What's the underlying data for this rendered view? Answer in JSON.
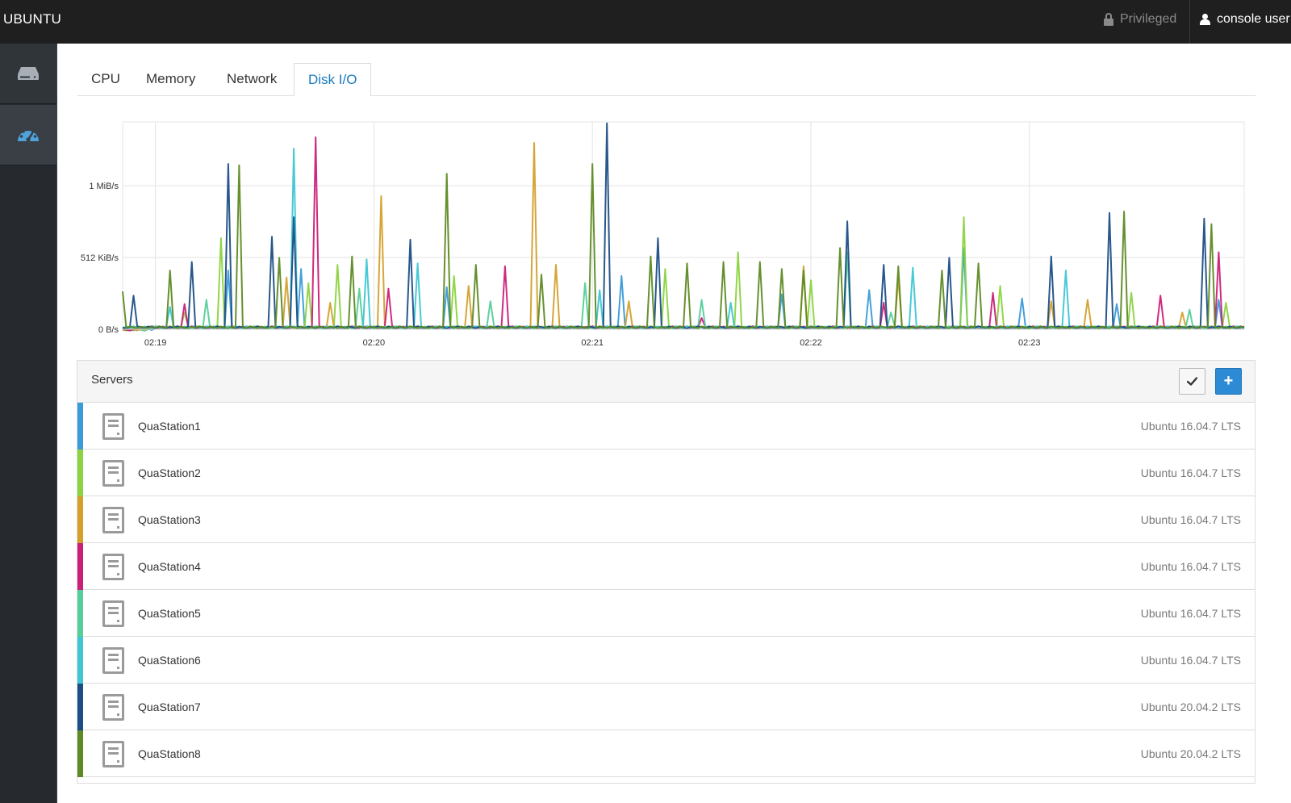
{
  "header": {
    "brand": "UBUNTU",
    "privileged_label": "Privileged",
    "user_label": "console user"
  },
  "sidebar": {
    "items": [
      {
        "icon": "server-rack-icon",
        "active": false
      },
      {
        "icon": "dashboard-gauge-icon",
        "active": true
      }
    ]
  },
  "tabs": [
    {
      "label": "CPU",
      "active": false
    },
    {
      "label": "Memory",
      "active": false
    },
    {
      "label": "Network",
      "active": false
    },
    {
      "label": "Disk I/O",
      "active": true
    }
  ],
  "chart_data": {
    "type": "line",
    "xlabel": "",
    "ylabel": "",
    "y_unit": "KiB/s",
    "y_ticks": [
      {
        "value": 0,
        "label": "0 B/s"
      },
      {
        "value": 512,
        "label": "512 KiB/s"
      },
      {
        "value": 1024,
        "label": "1 MiB/s"
      }
    ],
    "ylim": [
      0,
      1480
    ],
    "x_ticks": [
      "02:19",
      "02:20",
      "02:21",
      "02:22",
      "02:23"
    ],
    "x_range_seconds": [
      -9,
      299
    ],
    "grid": true,
    "series": [
      {
        "color": "#3b9bd8",
        "peaks": [
          [
            20,
            420
          ],
          [
            40,
            430
          ],
          [
            80,
            300
          ],
          [
            128,
            380
          ],
          [
            172,
            250
          ],
          [
            196,
            280
          ],
          [
            222,
            580
          ],
          [
            238,
            220
          ],
          [
            264,
            180
          ],
          [
            292,
            210
          ]
        ]
      },
      {
        "color": "#8bd43f",
        "peaks": [
          [
            8,
            120
          ],
          [
            18,
            650
          ],
          [
            42,
            330
          ],
          [
            50,
            460
          ],
          [
            82,
            380
          ],
          [
            140,
            430
          ],
          [
            160,
            550
          ],
          [
            180,
            350
          ],
          [
            222,
            800
          ],
          [
            232,
            310
          ],
          [
            268,
            260
          ],
          [
            294,
            190
          ]
        ]
      },
      {
        "color": "#d4a02c",
        "peaks": [
          [
            36,
            370
          ],
          [
            48,
            190
          ],
          [
            62,
            950
          ],
          [
            86,
            310
          ],
          [
            104,
            1330
          ],
          [
            110,
            460
          ],
          [
            130,
            200
          ],
          [
            178,
            450
          ],
          [
            204,
            370
          ],
          [
            246,
            200
          ],
          [
            256,
            210
          ],
          [
            282,
            120
          ]
        ]
      },
      {
        "color": "#cc1f7a",
        "peaks": [
          [
            8,
            180
          ],
          [
            44,
            1370
          ],
          [
            64,
            290
          ],
          [
            96,
            450
          ],
          [
            150,
            80
          ],
          [
            200,
            190
          ],
          [
            230,
            260
          ],
          [
            276,
            240
          ],
          [
            292,
            550
          ]
        ]
      },
      {
        "color": "#55cf9a",
        "peaks": [
          [
            14,
            210
          ],
          [
            56,
            290
          ],
          [
            92,
            200
          ],
          [
            118,
            330
          ],
          [
            150,
            210
          ],
          [
            190,
            550
          ],
          [
            202,
            120
          ],
          [
            284,
            140
          ]
        ]
      },
      {
        "color": "#3ec6d4",
        "peaks": [
          [
            4,
            160
          ],
          [
            38,
            1290
          ],
          [
            58,
            500
          ],
          [
            72,
            470
          ],
          [
            122,
            280
          ],
          [
            158,
            190
          ],
          [
            208,
            440
          ],
          [
            250,
            420
          ]
        ]
      },
      {
        "color": "#1c4e86",
        "peaks": [
          [
            -6,
            240
          ],
          [
            10,
            480
          ],
          [
            20,
            1180
          ],
          [
            32,
            660
          ],
          [
            38,
            800
          ],
          [
            70,
            640
          ],
          [
            124,
            1470
          ],
          [
            138,
            650
          ],
          [
            190,
            770
          ],
          [
            200,
            460
          ],
          [
            218,
            510
          ],
          [
            246,
            520
          ],
          [
            262,
            830
          ],
          [
            288,
            790
          ],
          [
            300,
            190
          ]
        ]
      },
      {
        "color": "#5e8a23",
        "peaks": [
          [
            -9,
            270
          ],
          [
            4,
            420
          ],
          [
            23,
            1170
          ],
          [
            34,
            510
          ],
          [
            54,
            520
          ],
          [
            80,
            1110
          ],
          [
            88,
            460
          ],
          [
            106,
            390
          ],
          [
            120,
            1180
          ],
          [
            136,
            520
          ],
          [
            146,
            470
          ],
          [
            156,
            480
          ],
          [
            166,
            480
          ],
          [
            172,
            430
          ],
          [
            178,
            420
          ],
          [
            188,
            580
          ],
          [
            204,
            450
          ],
          [
            216,
            420
          ],
          [
            226,
            470
          ],
          [
            266,
            840
          ],
          [
            290,
            750
          ]
        ]
      }
    ]
  },
  "servers": {
    "title": "Servers",
    "check_button_icon": "checkmark-icon",
    "add_button_label": "+",
    "rows": [
      {
        "name": "QuaStation1",
        "os": "Ubuntu 16.04.7 LTS",
        "color": "#3b9bd8"
      },
      {
        "name": "QuaStation2",
        "os": "Ubuntu 16.04.7 LTS",
        "color": "#8bd43f"
      },
      {
        "name": "QuaStation3",
        "os": "Ubuntu 16.04.7 LTS",
        "color": "#d4a02c"
      },
      {
        "name": "QuaStation4",
        "os": "Ubuntu 16.04.7 LTS",
        "color": "#cc1f7a"
      },
      {
        "name": "QuaStation5",
        "os": "Ubuntu 16.04.7 LTS",
        "color": "#55cf9a"
      },
      {
        "name": "QuaStation6",
        "os": "Ubuntu 16.04.7 LTS",
        "color": "#3ec6d4"
      },
      {
        "name": "QuaStation7",
        "os": "Ubuntu 20.04.2 LTS",
        "color": "#1c4e86"
      },
      {
        "name": "QuaStation8",
        "os": "Ubuntu 20.04.2 LTS",
        "color": "#5e8a23"
      }
    ]
  }
}
